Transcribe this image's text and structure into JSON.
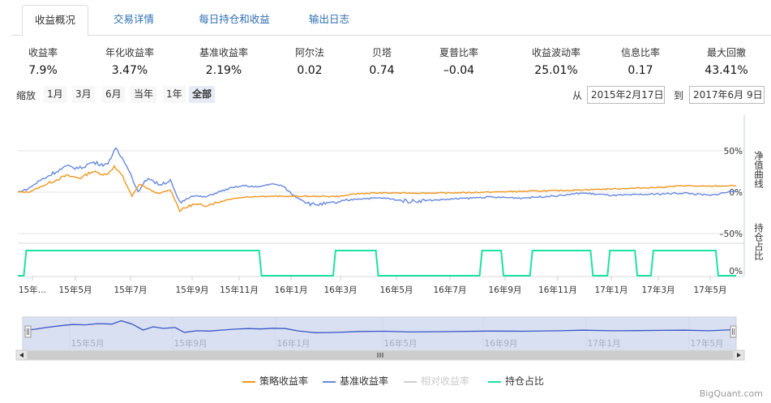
{
  "tabs": [
    {
      "label": "收益概况",
      "active": true
    },
    {
      "label": "交易详情",
      "active": false
    },
    {
      "label": "每日持仓和收益",
      "active": false
    },
    {
      "label": "输出日志",
      "active": false
    }
  ],
  "stats": [
    {
      "label": "收益率",
      "value": "7.9%"
    },
    {
      "label": "年化收益率",
      "value": "3.47%"
    },
    {
      "label": "基准收益率",
      "value": "2.19%"
    },
    {
      "label": "阿尔法",
      "value": "0.02"
    },
    {
      "label": "贝塔",
      "value": "0.74"
    },
    {
      "label": "夏普比率",
      "value": "–0.04"
    },
    {
      "label": "收益波动率",
      "value": "25.01%"
    },
    {
      "label": "信息比率",
      "value": "0.17"
    },
    {
      "label": "最大回撤",
      "value": "43.41%"
    }
  ],
  "range_selector": {
    "zoom_label": "缩放",
    "buttons": [
      {
        "label": "1月",
        "active": false
      },
      {
        "label": "3月",
        "active": false
      },
      {
        "label": "6月",
        "active": false
      },
      {
        "label": "当年",
        "active": false
      },
      {
        "label": "1年",
        "active": false
      },
      {
        "label": "全部",
        "active": true
      }
    ],
    "from_label": "从",
    "from_value": "2015年2月17日",
    "to_label": "到",
    "to_value": "2017年6月 9日"
  },
  "chart_data": {
    "type": "line",
    "x_range": [
      "2015-02-17",
      "2017-06-09"
    ],
    "main_panel": {
      "axis_title": "净值曲线",
      "y_ticks": [
        "50%",
        "0%",
        "–50%"
      ],
      "ylim": [
        -50,
        50
      ],
      "series": [
        {
          "name": "策略收益率",
          "color": "#f0961c",
          "points": [
            [
              "2015-02-17",
              0
            ],
            [
              "2015-03-01",
              0
            ],
            [
              "2015-03-15",
              6
            ],
            [
              "2015-04-01",
              14
            ],
            [
              "2015-04-15",
              20
            ],
            [
              "2015-05-01",
              17
            ],
            [
              "2015-05-15",
              25
            ],
            [
              "2015-06-01",
              21
            ],
            [
              "2015-06-10",
              31
            ],
            [
              "2015-06-20",
              19
            ],
            [
              "2015-07-01",
              -5
            ],
            [
              "2015-07-10",
              10
            ],
            [
              "2015-07-20",
              4
            ],
            [
              "2015-08-01",
              -2
            ],
            [
              "2015-08-15",
              3
            ],
            [
              "2015-08-26",
              -22
            ],
            [
              "2015-09-10",
              -15
            ],
            [
              "2015-09-25",
              -16
            ],
            [
              "2015-10-10",
              -12
            ],
            [
              "2015-10-25",
              -8
            ],
            [
              "2015-11-10",
              -6
            ],
            [
              "2015-11-25",
              -5
            ],
            [
              "2015-12-10",
              -5
            ],
            [
              "2015-12-31",
              -5
            ],
            [
              "2016-01-31",
              -5
            ],
            [
              "2016-03-01",
              -5
            ],
            [
              "2016-03-20",
              -2
            ],
            [
              "2016-04-10",
              -1
            ],
            [
              "2016-06-30",
              -1
            ],
            [
              "2016-08-20",
              0
            ],
            [
              "2016-10-01",
              1
            ],
            [
              "2016-11-15",
              2
            ],
            [
              "2016-12-15",
              3
            ],
            [
              "2017-01-15",
              4
            ],
            [
              "2017-02-15",
              5
            ],
            [
              "2017-03-15",
              6
            ],
            [
              "2017-04-10",
              8
            ],
            [
              "2017-05-01",
              7
            ],
            [
              "2017-06-09",
              7.9
            ]
          ]
        },
        {
          "name": "基准收益率",
          "color": "#6688dd",
          "points": [
            [
              "2015-02-17",
              0
            ],
            [
              "2015-03-01",
              4
            ],
            [
              "2015-03-15",
              14
            ],
            [
              "2015-04-01",
              24
            ],
            [
              "2015-04-15",
              31
            ],
            [
              "2015-05-01",
              29
            ],
            [
              "2015-05-15",
              36
            ],
            [
              "2015-06-01",
              33
            ],
            [
              "2015-06-12",
              52
            ],
            [
              "2015-06-25",
              33
            ],
            [
              "2015-07-08",
              0
            ],
            [
              "2015-07-20",
              18
            ],
            [
              "2015-08-01",
              9
            ],
            [
              "2015-08-15",
              14
            ],
            [
              "2015-08-26",
              -13
            ],
            [
              "2015-09-10",
              -4
            ],
            [
              "2015-09-25",
              -6
            ],
            [
              "2015-10-10",
              0
            ],
            [
              "2015-10-25",
              5
            ],
            [
              "2015-11-10",
              8
            ],
            [
              "2015-11-25",
              6
            ],
            [
              "2015-12-10",
              10
            ],
            [
              "2015-12-24",
              8
            ],
            [
              "2016-01-08",
              -5
            ],
            [
              "2016-01-28",
              -15
            ],
            [
              "2016-02-15",
              -14
            ],
            [
              "2016-03-01",
              -12
            ],
            [
              "2016-03-20",
              -8
            ],
            [
              "2016-04-20",
              -7
            ],
            [
              "2016-05-20",
              -11
            ],
            [
              "2016-06-30",
              -9
            ],
            [
              "2016-08-20",
              -6
            ],
            [
              "2016-10-01",
              -7
            ],
            [
              "2016-11-15",
              -4
            ],
            [
              "2016-12-10",
              -1
            ],
            [
              "2017-01-15",
              -4
            ],
            [
              "2017-02-15",
              -3
            ],
            [
              "2017-03-15",
              -2
            ],
            [
              "2017-04-10",
              -1
            ],
            [
              "2017-05-10",
              -4
            ],
            [
              "2017-06-09",
              2.19
            ]
          ]
        }
      ]
    },
    "position_panel": {
      "axis_title": "持仓占比",
      "y_ticks": [
        "0%"
      ],
      "series": {
        "name": "持仓占比",
        "color": "#1ee1a4",
        "on_intervals": [
          [
            "2015-02-24",
            "2015-11-30"
          ],
          [
            "2016-02-22",
            "2016-04-15"
          ],
          [
            "2016-08-12",
            "2016-09-09"
          ],
          [
            "2016-10-10",
            "2016-12-23"
          ],
          [
            "2017-01-09",
            "2017-02-13"
          ],
          [
            "2017-03-01",
            "2017-05-19"
          ]
        ]
      }
    },
    "x_ticks": [
      "15年…",
      "15年5月",
      "15年7月",
      "15年9月",
      "15年11月",
      "16年1月",
      "16年3月",
      "16年5月",
      "16年7月",
      "16年9月",
      "16年11月",
      "17年1月",
      "17年3月",
      "17年5月"
    ],
    "navigator": {
      "x_ticks": [
        "15年5月",
        "15年9月",
        "16年1月",
        "16年5月",
        "16年9月",
        "17年1月",
        "17年5月"
      ],
      "series_color": "#3a56c4",
      "fill_color": "#c9d3ee"
    },
    "legend": [
      {
        "name": "策略收益率",
        "color": "#f0961c",
        "enabled": true
      },
      {
        "name": "基准收益率",
        "color": "#6688dd",
        "enabled": true
      },
      {
        "name": "相对收益率",
        "color": "#cccccc",
        "enabled": false
      },
      {
        "name": "持仓占比",
        "color": "#1ee1a4",
        "enabled": true
      }
    ]
  },
  "credit": "BigQuant.com"
}
